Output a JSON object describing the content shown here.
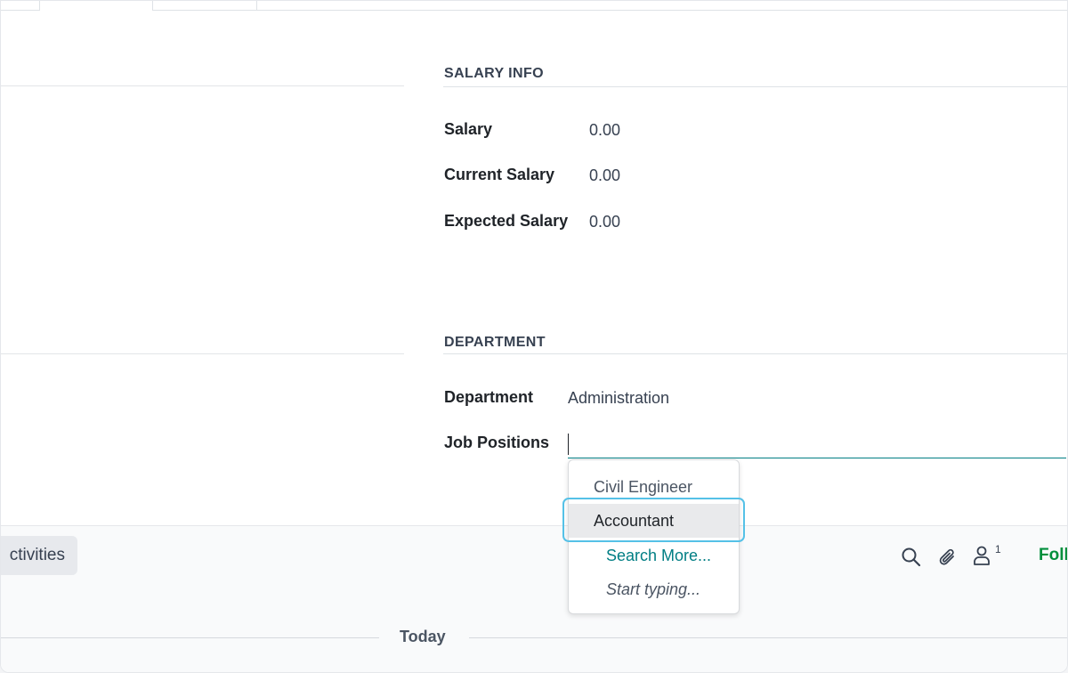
{
  "salary_info": {
    "title": "SALARY INFO",
    "salary_label": "Salary",
    "salary_value": "0.00",
    "current_salary_label": "Current Salary",
    "current_salary_value": "0.00",
    "expected_salary_label": "Expected Salary",
    "expected_salary_value": "0.00"
  },
  "department_section": {
    "title": "DEPARTMENT",
    "department_label": "Department",
    "department_value": "Administration",
    "job_positions_label": "Job Positions",
    "job_positions_value": ""
  },
  "dropdown": {
    "options": [
      "Civil Engineer",
      "Accountant"
    ],
    "search_more": "Search More...",
    "start_typing": "Start typing..."
  },
  "chatter": {
    "activities_label": "ctivities",
    "followers_count": "1",
    "follow_label": "Follow",
    "today_label": "Today"
  },
  "colors": {
    "accent": "#017e84",
    "focus_ring": "#55c1e7",
    "follow": "#008f3c"
  },
  "icons": [
    "search-icon",
    "paperclip-icon",
    "user-icon"
  ]
}
